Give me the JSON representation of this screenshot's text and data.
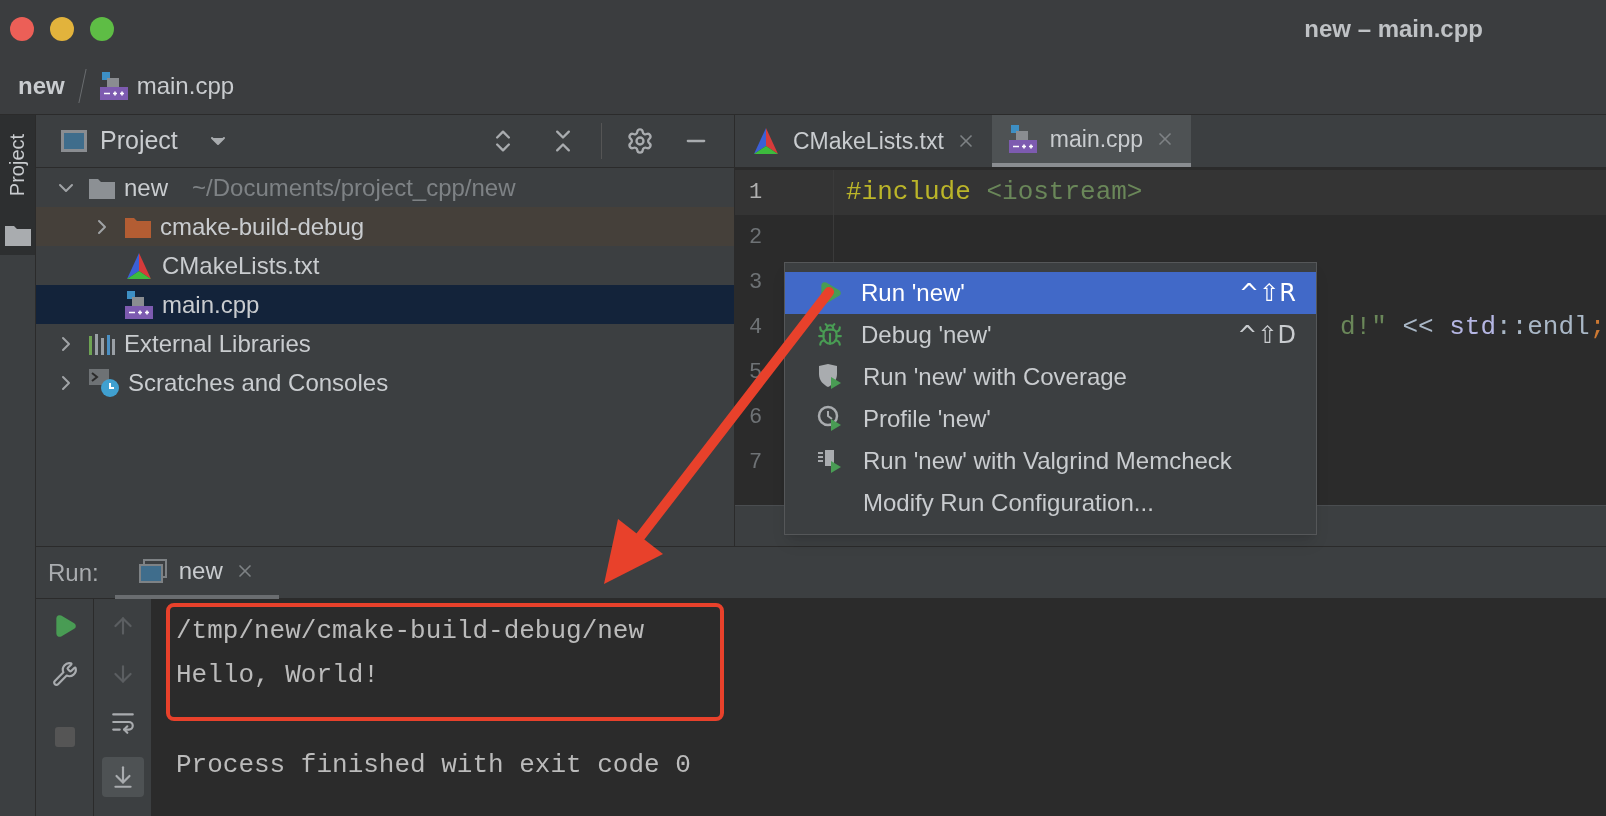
{
  "window": {
    "title": "new – main.cpp"
  },
  "breadcrumb": [
    {
      "label": "new",
      "kind": "project"
    },
    {
      "label": "main.cpp",
      "kind": "cpp"
    }
  ],
  "side_strip": {
    "label": "Project",
    "selected": true
  },
  "project_panel": {
    "title": "Project",
    "tree": [
      {
        "label": "new",
        "path": "~/Documents/project_cpp/new",
        "kind": "folder",
        "expanded": true,
        "selected": false,
        "children": [
          {
            "label": "cmake-build-debug",
            "kind": "build-folder",
            "expanded": false,
            "selected": false
          },
          {
            "label": "CMakeLists.txt",
            "kind": "cmake",
            "selected": false
          },
          {
            "label": "main.cpp",
            "kind": "cpp",
            "selected": true
          }
        ]
      },
      {
        "label": "External Libraries",
        "kind": "libraries",
        "expanded": false,
        "selected": false
      },
      {
        "label": "Scratches and Consoles",
        "kind": "scratches",
        "expanded": false,
        "selected": false
      }
    ]
  },
  "editor": {
    "tabs": [
      {
        "label": "CMakeLists.txt",
        "kind": "cmake",
        "selected": false
      },
      {
        "label": "main.cpp",
        "kind": "cpp",
        "selected": true
      }
    ],
    "lines": [
      {
        "number": "1",
        "current": true,
        "tokens": [
          {
            "text": "#include",
            "kind": "directive"
          },
          {
            "text": " <iostream>",
            "kind": "string"
          }
        ]
      },
      {
        "number": "2",
        "current": false
      },
      {
        "number": "3",
        "current": false
      },
      {
        "number": "4",
        "current": false,
        "covered": true,
        "tokens": [
          {
            "text": "d!\"",
            "kind": "string"
          },
          {
            "text": " << ",
            "kind": "plain"
          },
          {
            "text": "std",
            "kind": "namespace"
          },
          {
            "text": "::endl",
            "kind": "plain"
          },
          {
            "text": ";",
            "kind": "punct"
          }
        ]
      },
      {
        "number": "5",
        "current": false
      },
      {
        "number": "6",
        "current": false
      },
      {
        "number": "7",
        "current": false
      }
    ]
  },
  "context_menu": {
    "items": [
      {
        "label": "Run 'new'",
        "shortcut": "^⇧R",
        "kind": "run",
        "selected": true
      },
      {
        "label": "Debug 'new'",
        "shortcut": "^⇧D",
        "kind": "debug",
        "selected": false
      },
      {
        "label": "Run 'new' with Coverage",
        "kind": "coverage",
        "selected": false
      },
      {
        "label": "Profile 'new'",
        "kind": "profile",
        "selected": false
      },
      {
        "label": "Run 'new' with Valgrind Memcheck",
        "kind": "valgrind",
        "selected": false
      },
      {
        "label": "Modify Run Configuration...",
        "kind": "plain",
        "selected": false
      }
    ]
  },
  "run_panel": {
    "label": "Run:",
    "tabs": [
      {
        "label": "new",
        "selected": true
      }
    ],
    "scroll_to_end": true,
    "output": [
      {
        "text": "/tmp/new/cmake-build-debug/new",
        "boxed": true
      },
      {
        "text": "Hello, World!",
        "boxed": true
      },
      {
        "text": "Process finished with exit code 0",
        "boxed": false
      }
    ]
  }
}
